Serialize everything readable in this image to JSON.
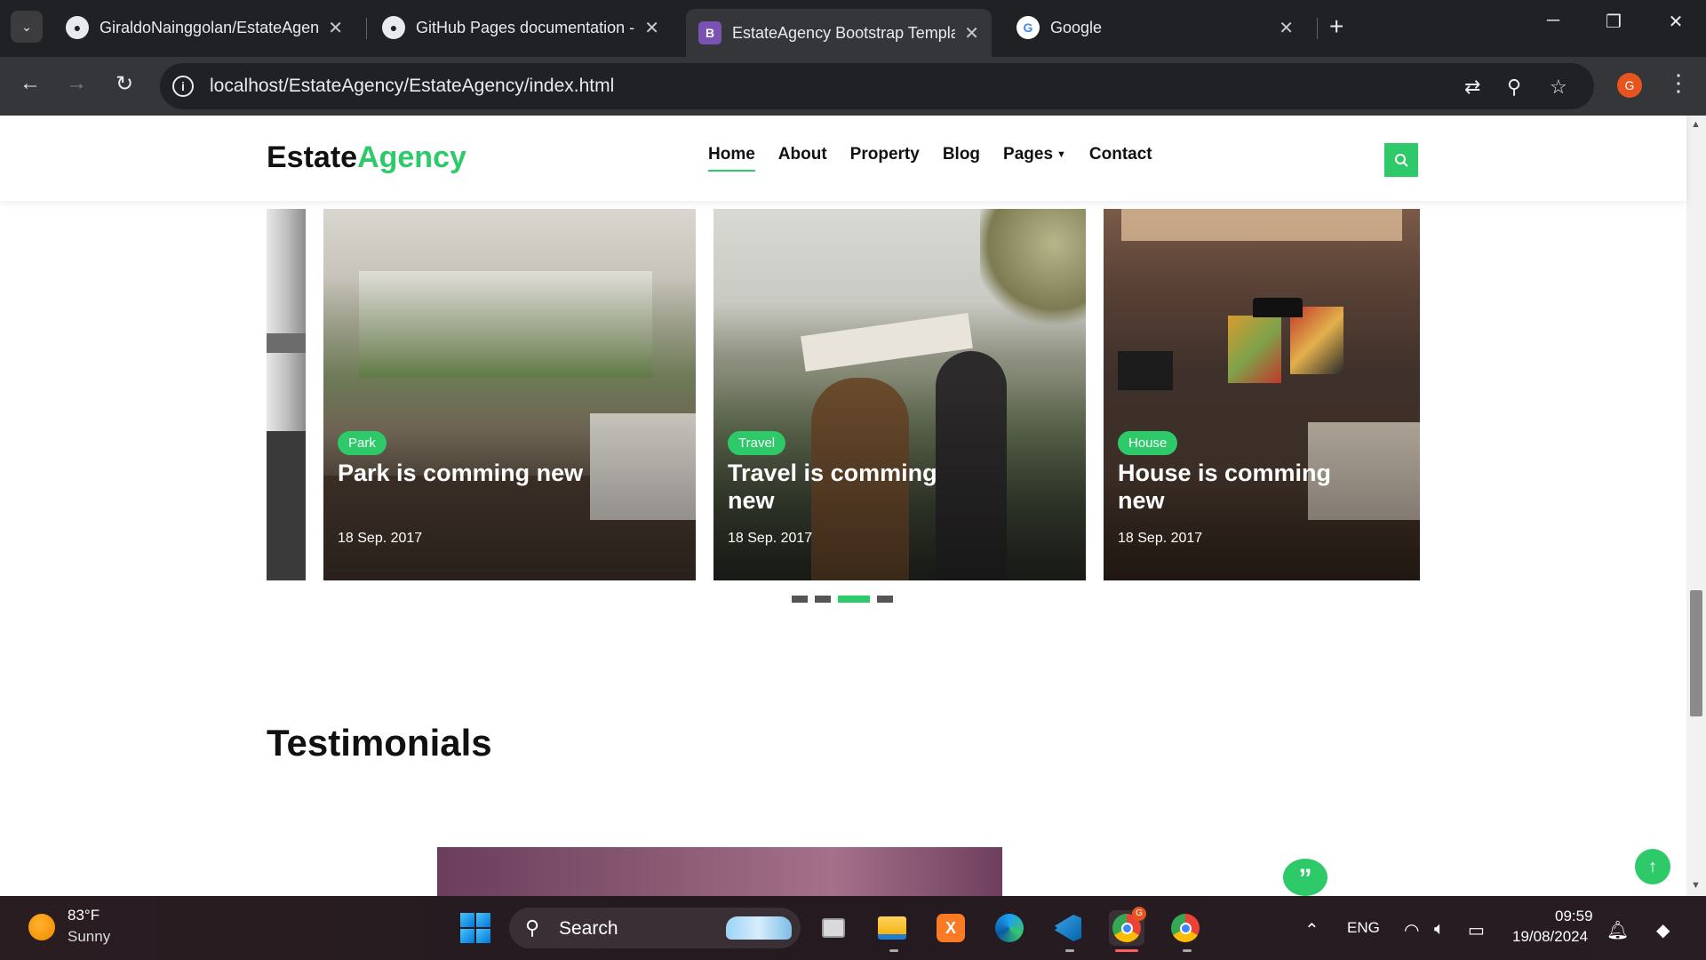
{
  "browser": {
    "tabs": [
      {
        "title": "GiraldoNainggolan/EstateAgency",
        "icon": "github-icon",
        "active": false
      },
      {
        "title": "GitHub Pages documentation -",
        "icon": "github-icon",
        "active": false
      },
      {
        "title": "EstateAgency Bootstrap Templa",
        "icon": "bootstrap-icon",
        "active": true
      },
      {
        "title": "Google",
        "icon": "google-icon",
        "active": false
      }
    ],
    "url": "localhost/EstateAgency/EstateAgency/index.html",
    "profile_initial": "G",
    "icon_glyphs": {
      "close": "✕",
      "new_tab": "+",
      "back": "←",
      "forward": "→",
      "reload": "↻",
      "star": "☆",
      "zoom": "⚲",
      "translate": "⇄",
      "menu": "⋮",
      "minimize": "─",
      "restore": "❐",
      "window_close": "✕",
      "bootstrap": "B",
      "github": "●",
      "google": "G"
    }
  },
  "site": {
    "logo_part1": "Estate",
    "logo_part2": "Agency",
    "nav": [
      {
        "label": "Home",
        "active": true
      },
      {
        "label": "About",
        "active": false
      },
      {
        "label": "Property",
        "active": false
      },
      {
        "label": "Blog",
        "active": false
      },
      {
        "label": "Pages",
        "active": false,
        "dropdown": true
      },
      {
        "label": "Contact",
        "active": false
      }
    ],
    "accent_color": "#2eca6a",
    "news_cards": [
      {
        "badge": "Park",
        "title": "Park is comming new",
        "date": "18 Sep. 2017"
      },
      {
        "badge": "Travel",
        "title": "Travel is comming new",
        "date": "18 Sep. 2017"
      },
      {
        "badge": "House",
        "title": "House is comming new",
        "date": "18 Sep. 2017"
      }
    ],
    "carousel_pages": 4,
    "carousel_active_page": 3,
    "testimonials_title": "Testimonials"
  },
  "taskbar": {
    "temperature": "83°F",
    "weather": "Sunny",
    "search_label": "Search",
    "language": "ENG",
    "time": "09:59",
    "date": "19/08/2024",
    "chrome_badge": "G",
    "apps": [
      "start-icon",
      "search",
      "task-view-icon",
      "file-explorer-icon",
      "xampp-icon",
      "edge-icon",
      "vscode-icon",
      "chrome-icon",
      "chrome-profile-icon"
    ]
  }
}
